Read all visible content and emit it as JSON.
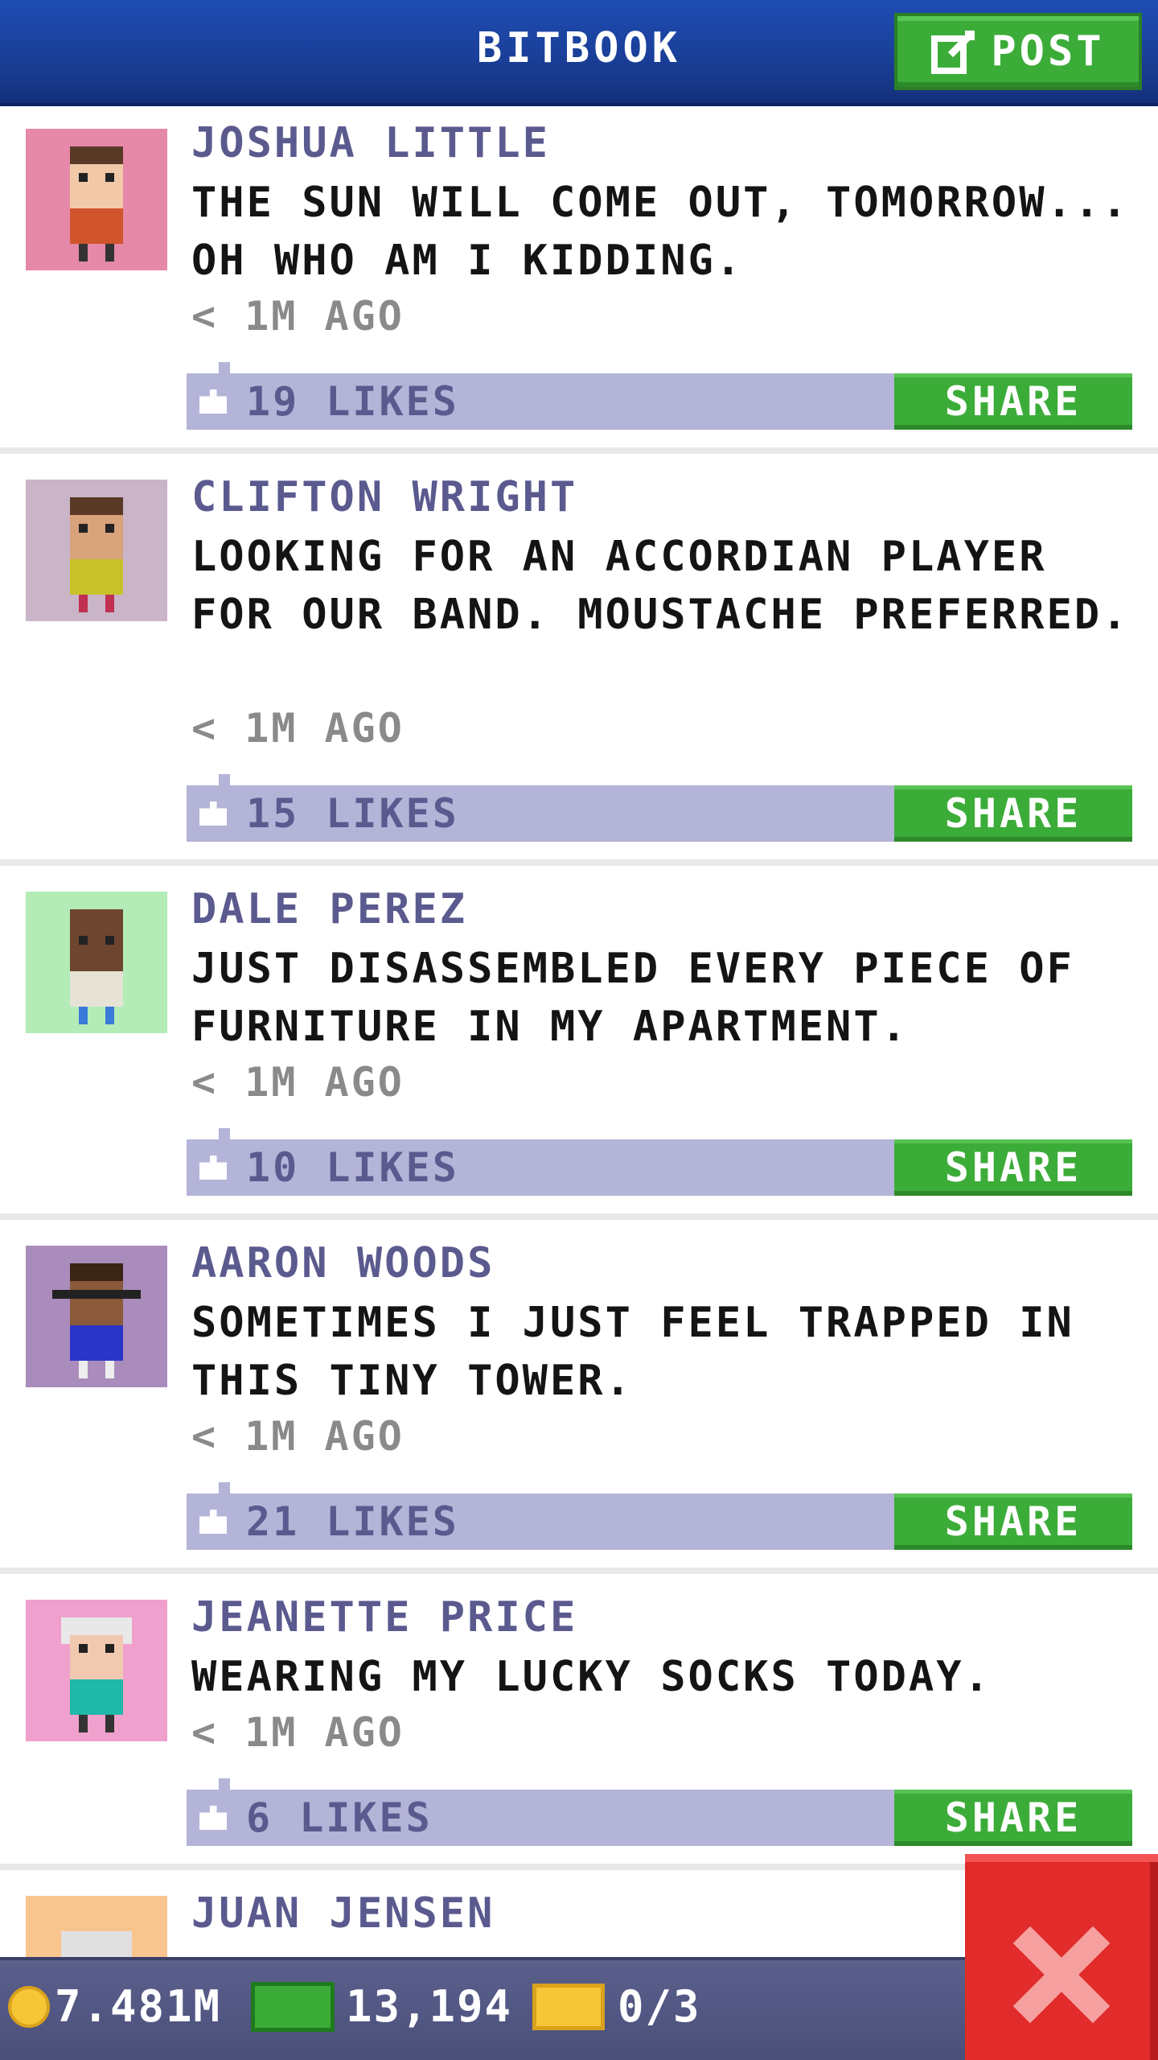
{
  "header": {
    "title": "BITBOOK",
    "post_label": "POST"
  },
  "posts": [
    {
      "name": "JOSHUA LITTLE",
      "message": "THE SUN WILL COME OUT, TOMORROW... OH WHO AM I KIDDING.",
      "time": "< 1M AGO",
      "likes": "19 LIKES",
      "share_label": "SHARE",
      "avatar_bg": "#e688a8"
    },
    {
      "name": "CLIFTON WRIGHT",
      "message": "LOOKING FOR AN ACCORDIAN PLAYER FOR OUR BAND. MOUSTACHE PREFERRED.",
      "time": "< 1M AGO",
      "likes": "15 LIKES",
      "share_label": "SHARE",
      "avatar_bg": "#c9b4c8"
    },
    {
      "name": "DALE PEREZ",
      "message": "JUST DISASSEMBLED EVERY PIECE OF FURNITURE IN MY APARTMENT.",
      "time": "< 1M AGO",
      "likes": "10 LIKES",
      "share_label": "SHARE",
      "avatar_bg": "#b4ecb8"
    },
    {
      "name": "AARON WOODS",
      "message": "SOMETIMES I JUST FEEL TRAPPED IN THIS TINY TOWER.",
      "time": "< 1M AGO",
      "likes": "21 LIKES",
      "share_label": "SHARE",
      "avatar_bg": "#a98cbb"
    },
    {
      "name": "JEANETTE PRICE",
      "message": "WEARING MY LUCKY SOCKS TODAY.",
      "time": "< 1M AGO",
      "likes": "6 LIKES",
      "share_label": "SHARE",
      "avatar_bg": "#f0a0cc"
    },
    {
      "name": "JUAN JENSEN",
      "avatar_bg": "#f9c58e"
    }
  ],
  "status_bar": {
    "coins": "7.481M",
    "bux": "13,194",
    "tickets": "0/3"
  },
  "colors": {
    "header_blue": "#1a3f99",
    "button_green": "#3cac39",
    "likes_bar": "#b4b4d8",
    "name_purple": "#5b5a8f",
    "close_red": "#e22b2b"
  },
  "icons": {
    "post": "compose-icon",
    "like": "thumbs-up-icon",
    "coins": "coin-icon",
    "bux": "bux-icon",
    "tickets": "ticket-icon",
    "close": "close-icon"
  }
}
